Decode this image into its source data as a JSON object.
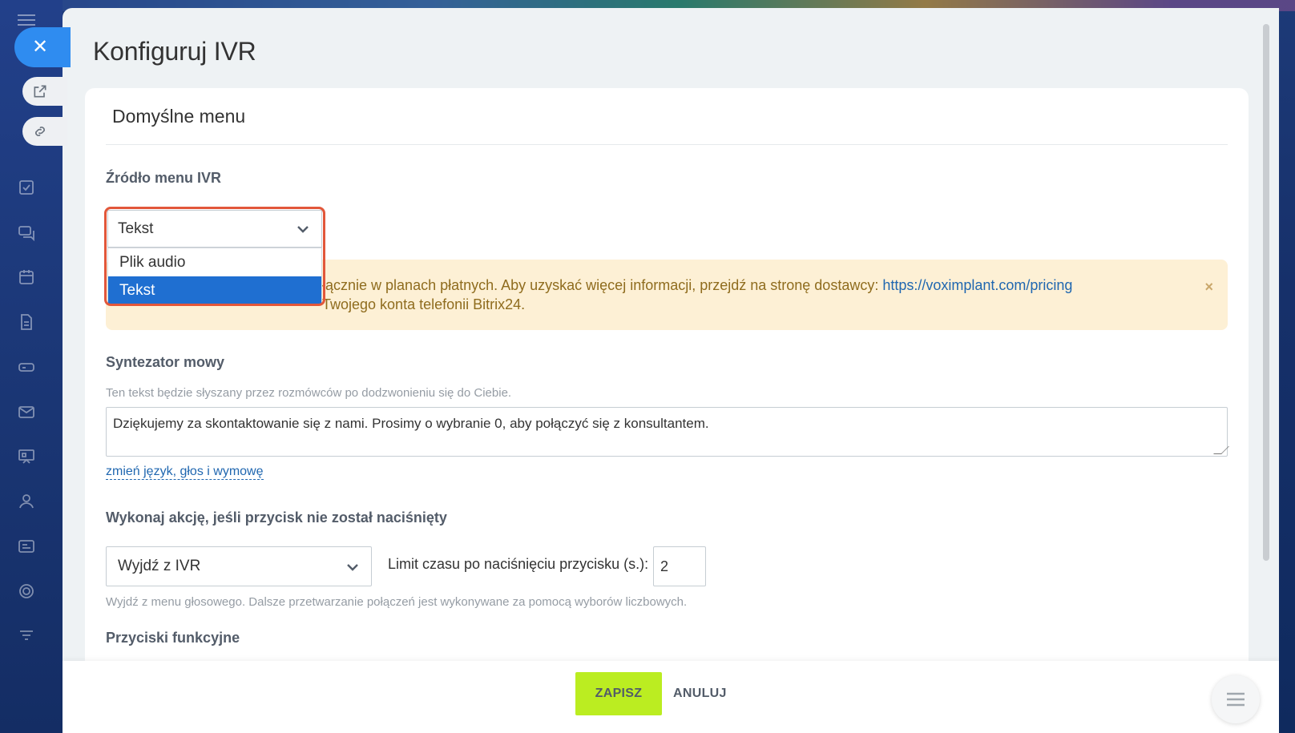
{
  "slider": {
    "title": "Konfiguruj IVR"
  },
  "card": {
    "header": "Domyślne menu",
    "source": {
      "label": "Źródło menu IVR",
      "selected": "Tekst",
      "options": [
        "Plik audio",
        "Tekst"
      ],
      "highlighted_option": "Tekst"
    },
    "warning": {
      "line1_prefix": "łącznie w planach płatnych. Aby uzyskać więcej informacji, przejdź na stronę dostawcy: ",
      "line1_link": "https://voximplant.com/pricing",
      "line2": "Twojego konta telefonii Bitrix24.",
      "close": "×"
    },
    "tts": {
      "label": "Syntezator mowy",
      "hint": "Ten tekst będzie słyszany przez rozmówców po dodzwonieniu się do Ciebie.",
      "text": "Dziękujemy za skontaktowanie się z nami. Prosimy o wybranie 0, aby połączyć się z konsultantem.",
      "link": "zmień język, głos i wymowę"
    },
    "no_press": {
      "label": "Wykonaj akcję, jeśli przycisk nie został naciśnięty",
      "action_selected": "Wyjdź z IVR",
      "timeout_label": "Limit czasu po naciśnięciu przycisku (s.):",
      "timeout_value": "2",
      "hint": "Wyjdź z menu głosowego. Dalsze przetwarzanie połączeń jest wykonywane za pomocą wyborów liczbowych."
    },
    "function_buttons": {
      "label": "Przyciski funkcyjne"
    }
  },
  "footer": {
    "save_label": "ZAPISZ",
    "cancel_label": "ANULUJ"
  },
  "colors": {
    "save_button": "#bbed21",
    "selected_option": "#1f6fd1",
    "highlight_border": "#e2573a",
    "warning_bg": "#fdf0d5",
    "link": "#2067b0",
    "close_button": "#2f8cf0"
  }
}
